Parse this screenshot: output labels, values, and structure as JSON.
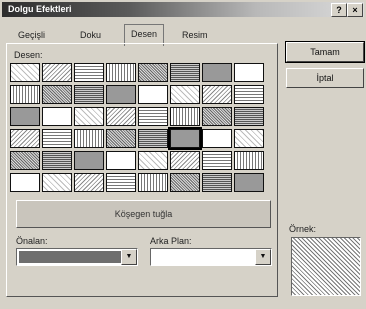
{
  "window": {
    "title": "Dolgu Efektleri",
    "help": "?",
    "close": "×"
  },
  "tabs": [
    {
      "label": "Geçişli"
    },
    {
      "label": "Doku"
    },
    {
      "label": "Desen"
    },
    {
      "label": "Resim"
    }
  ],
  "pattern": {
    "label": "Desen:",
    "selected_name": "Köşegen tuğla"
  },
  "foreground": {
    "label": "Önalan:"
  },
  "background": {
    "label": "Arka Plan:"
  },
  "buttons": {
    "ok": "Tamam",
    "cancel": "İptal"
  },
  "sample": {
    "label": "Örnek:"
  },
  "colors": {
    "foreground": "#6e6e6e",
    "background": "#ffffff"
  },
  "icons": {
    "dropdown": "chevron-down-icon",
    "help": "question-icon",
    "close": "close-icon"
  }
}
